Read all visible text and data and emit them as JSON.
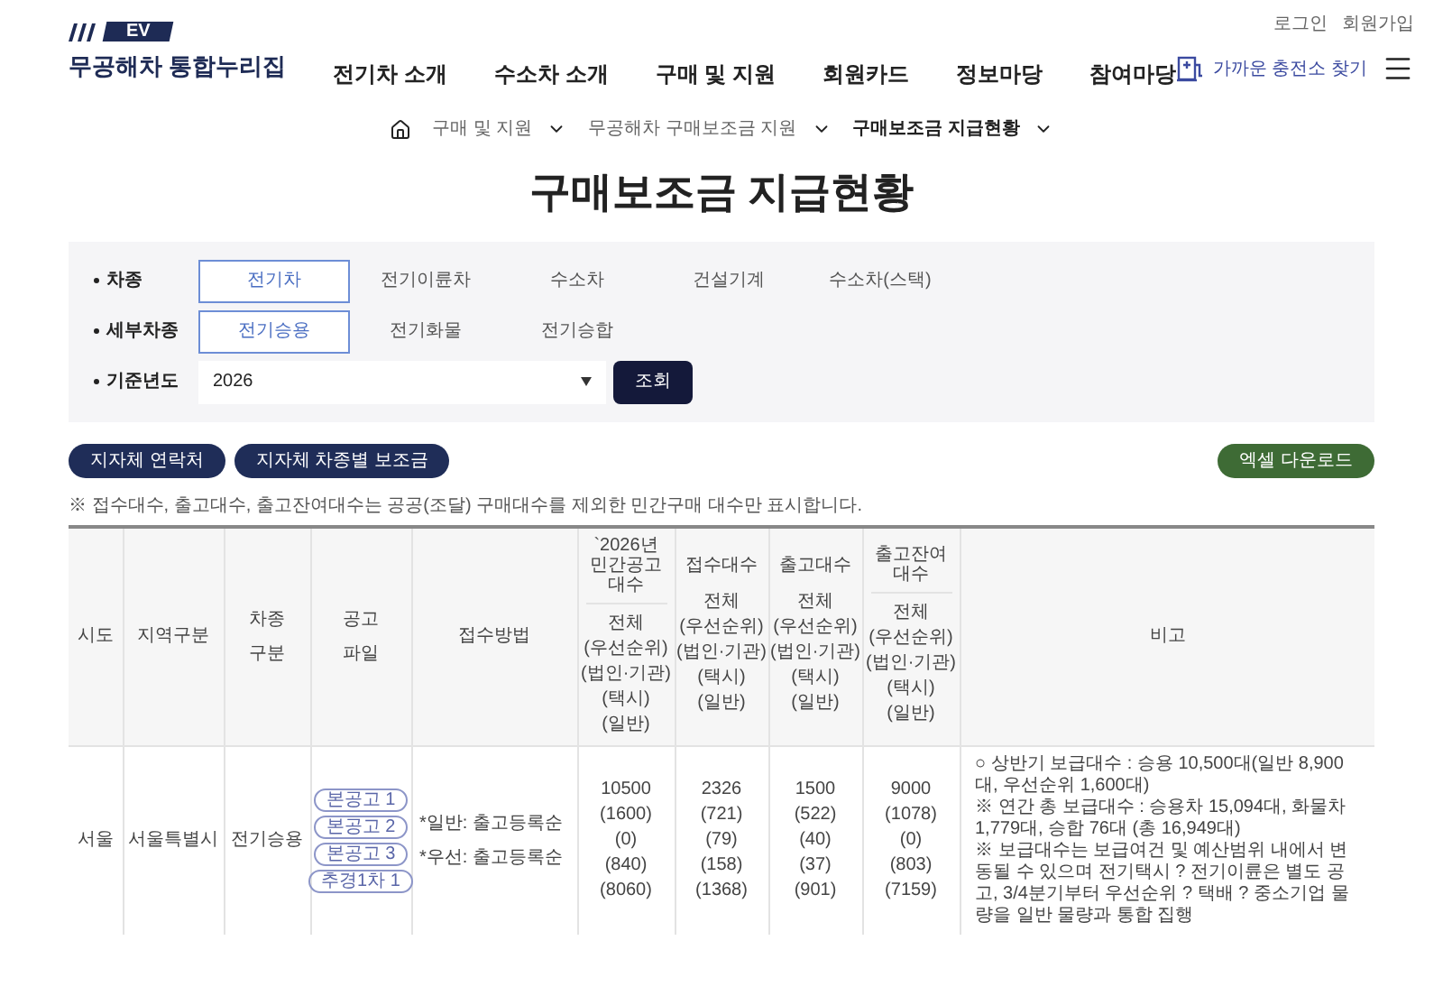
{
  "site": {
    "logo_badge": "EV",
    "logo_text": "무공해차 통합누리집",
    "top_links": [
      "로그인",
      "회원가입"
    ],
    "nav": [
      "전기차 소개",
      "수소차 소개",
      "구매 및 지원",
      "회원카드",
      "정보마당",
      "참여마당"
    ],
    "charger_link": "가까운 충전소 찾기"
  },
  "breadcrumb": [
    "구매 및 지원",
    "무공해차 구매보조금 지원",
    "구매보조금 지급현황"
  ],
  "title": "구매보조금 지급현황",
  "filters": [
    {
      "label": "차종",
      "kind": "options",
      "options": [
        {
          "label": "전기차",
          "selected": true
        },
        {
          "label": "전기이륜차",
          "selected": false
        },
        {
          "label": "수소차",
          "selected": false
        },
        {
          "label": "건설기계",
          "selected": false
        },
        {
          "label": "수소차(스택)",
          "selected": false
        }
      ]
    },
    {
      "label": "세부차종",
      "kind": "options",
      "options": [
        {
          "label": "전기승용",
          "selected": true
        },
        {
          "label": "전기화물",
          "selected": false
        },
        {
          "label": "전기승합",
          "selected": false
        }
      ]
    },
    {
      "label": "기준년도",
      "kind": "select",
      "value": "2026"
    }
  ],
  "search_button": "조회",
  "buttons": [
    {
      "label": "지자체 연락처",
      "kind": "navy"
    },
    {
      "label": "지자체 차종별 보조금",
      "kind": "navy"
    },
    {
      "label": "엑셀 다운로드",
      "kind": "green"
    }
  ],
  "note": "※ 접수대수, 출고대수, 출고잔여대수는 공공(조달) 구매대수를 제외한 민간구매 대수만 표시합니다.",
  "table": {
    "columns": [
      {
        "kind": "text",
        "lines": [
          "시도"
        ]
      },
      {
        "kind": "text",
        "lines": [
          "지역구분"
        ]
      },
      {
        "kind": "text",
        "lines": [
          "차종",
          "구분"
        ]
      },
      {
        "kind": "text",
        "lines": [
          "공고",
          "파일"
        ]
      },
      {
        "kind": "text",
        "lines": [
          "접수방법"
        ]
      },
      {
        "kind": "count",
        "divided": true,
        "title_lines": [
          "`2026년",
          "민간공고",
          "대수"
        ],
        "sub_lines": [
          "전체",
          "(우선순위)",
          "(법인·기관)",
          "(택시)",
          "(일반)"
        ]
      },
      {
        "kind": "count",
        "divided": false,
        "title_lines": [
          "접수대수"
        ],
        "sub_lines": [
          "전체",
          "(우선순위)",
          "(법인·기관)",
          "(택시)",
          "(일반)"
        ]
      },
      {
        "kind": "count",
        "divided": false,
        "title_lines": [
          "출고대수"
        ],
        "sub_lines": [
          "전체",
          "(우선순위)",
          "(법인·기관)",
          "(택시)",
          "(일반)"
        ]
      },
      {
        "kind": "count",
        "divided": true,
        "title_lines": [
          "출고잔여",
          "대수"
        ],
        "sub_lines": [
          "전체",
          "(우선순위)",
          "(법인·기관)",
          "(택시)",
          "(일반)"
        ]
      },
      {
        "kind": "text",
        "lines": [
          "비고"
        ]
      }
    ],
    "rows": [
      {
        "sido": "서울",
        "region": "서울특별시",
        "vehicle": "전기승용",
        "files": [
          "본공고 1",
          "본공고 2",
          "본공고 3",
          "추경1차 1"
        ],
        "method_lines": [
          "*일반: 출고등록순",
          "*우선: 출고등록순"
        ],
        "counts": [
          [
            "10500",
            "(1600)",
            "(0)",
            "(840)",
            "(8060)"
          ],
          [
            "2326",
            "(721)",
            "(79)",
            "(158)",
            "(1368)"
          ],
          [
            "1500",
            "(522)",
            "(40)",
            "(37)",
            "(901)"
          ],
          [
            "9000",
            "(1078)",
            "(0)",
            "(803)",
            "(7159)"
          ]
        ],
        "remarks": [
          "○ 상반기 보급대수 : 승용 10,500대(일반 8,900대, 우선순위 1,600대)",
          "※ 연간 총 보급대수 : 승용차 15,094대, 화물차 1,779대, 승합 76대 (총 16,949대)",
          "※ 보급대수는 보급여건 및 예산범위 내에서 변동될 수 있으며 전기택시 ? 전기이륜은 별도 공고, 3/4분기부터 우선순위 ? 택배 ? 중소기업 물량을 일반 물량과 통합 집행"
        ]
      }
    ]
  }
}
